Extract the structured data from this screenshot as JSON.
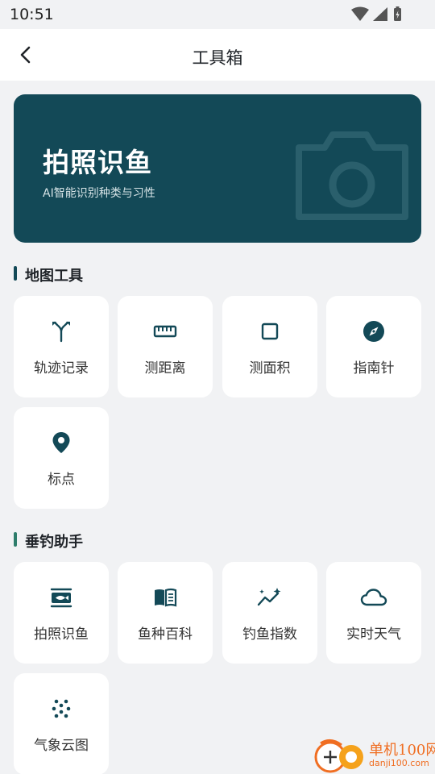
{
  "status_bar": {
    "time": "10:51"
  },
  "header": {
    "title": "工具箱"
  },
  "banner": {
    "title": "拍照识鱼",
    "subtitle": "AI智能识别种类与习性",
    "bg_color": "#134957"
  },
  "sections": [
    {
      "title": "地图工具",
      "accent_color": "#134957",
      "tools": [
        {
          "label": "轨迹记录",
          "icon": "route-split-icon"
        },
        {
          "label": "测距离",
          "icon": "ruler-icon"
        },
        {
          "label": "测面积",
          "icon": "square-outline-icon"
        },
        {
          "label": "指南针",
          "icon": "compass-icon"
        },
        {
          "label": "标点",
          "icon": "map-pin-icon"
        }
      ]
    },
    {
      "title": "垂钓助手",
      "accent_color": "#2e7d6b",
      "tools": [
        {
          "label": "拍照识鱼",
          "icon": "fish-scan-icon"
        },
        {
          "label": "鱼种百科",
          "icon": "book-open-icon"
        },
        {
          "label": "钓鱼指数",
          "icon": "trend-sparkle-icon"
        },
        {
          "label": "实时天气",
          "icon": "cloud-icon"
        },
        {
          "label": "气象云图",
          "icon": "dots-pattern-icon"
        }
      ]
    }
  ],
  "watermark": {
    "line1": "单机100网",
    "line2": "danji100.com"
  }
}
